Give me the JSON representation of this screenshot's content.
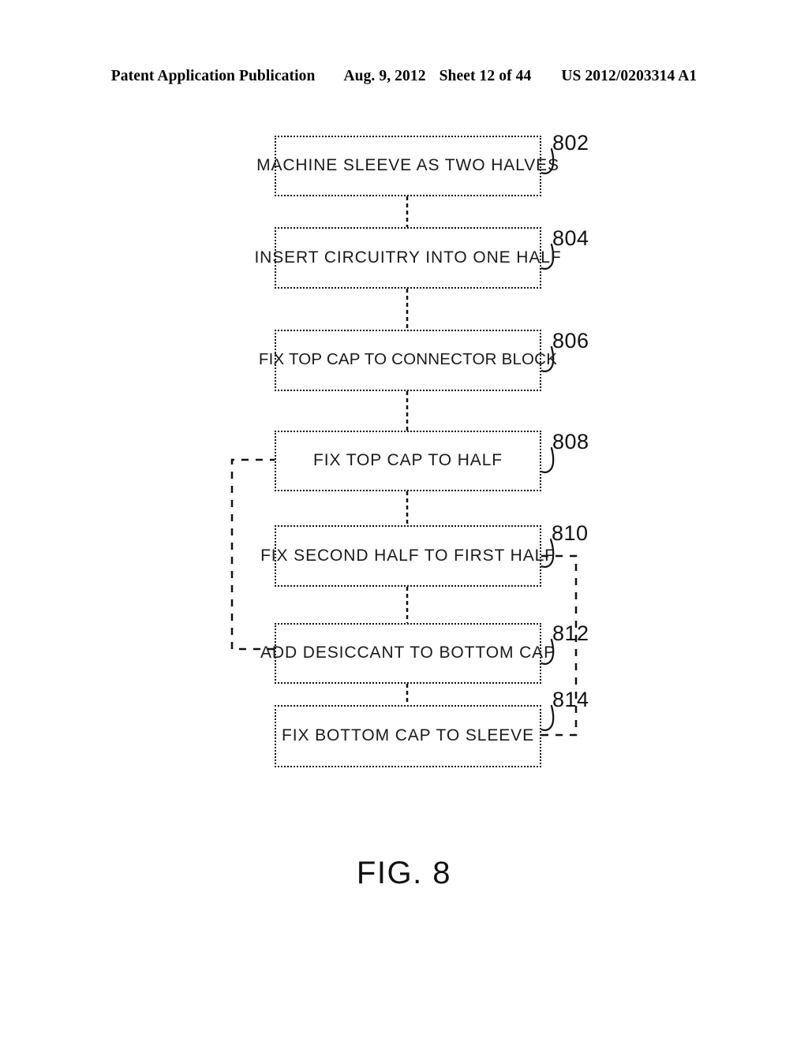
{
  "header": {
    "publication": "Patent Application Publication",
    "date": "Aug. 9, 2012",
    "sheet": "Sheet 12 of 44",
    "patent_number": "US 2012/0203314 A1"
  },
  "figure": {
    "caption": "FIG. 8",
    "type": "flowchart",
    "ink_color": "#111111",
    "background_color": "#ffffff",
    "line_style": "dotted"
  },
  "flowchart": {
    "steps": [
      {
        "ref": "802",
        "label": "MACHINE SLEEVE AS TWO HALVES"
      },
      {
        "ref": "804",
        "label": "INSERT CIRCUITRY INTO ONE HALF"
      },
      {
        "ref": "806",
        "label": "FIX TOP CAP TO CONNECTOR BLOCK"
      },
      {
        "ref": "808",
        "label": "FIX TOP CAP TO HALF"
      },
      {
        "ref": "810",
        "label": "FIX SECOND HALF TO FIRST HALF"
      },
      {
        "ref": "812",
        "label": "ADD DESICCANT TO BOTTOM CAP"
      },
      {
        "ref": "814",
        "label": "FIX BOTTOM CAP TO SLEEVE"
      }
    ],
    "connections": [
      {
        "from": "802",
        "to": "804",
        "kind": "sequential-down"
      },
      {
        "from": "804",
        "to": "806",
        "kind": "sequential-down"
      },
      {
        "from": "806",
        "to": "808",
        "kind": "sequential-down"
      },
      {
        "from": "808",
        "to": "810",
        "kind": "sequential-down"
      },
      {
        "from": "810",
        "to": "812",
        "kind": "sequential-down"
      },
      {
        "from": "812",
        "to": "814",
        "kind": "sequential-down"
      },
      {
        "from": "812",
        "to": "808",
        "kind": "feedback-left"
      },
      {
        "from": "810",
        "to": "814",
        "kind": "feedback-right"
      }
    ]
  }
}
